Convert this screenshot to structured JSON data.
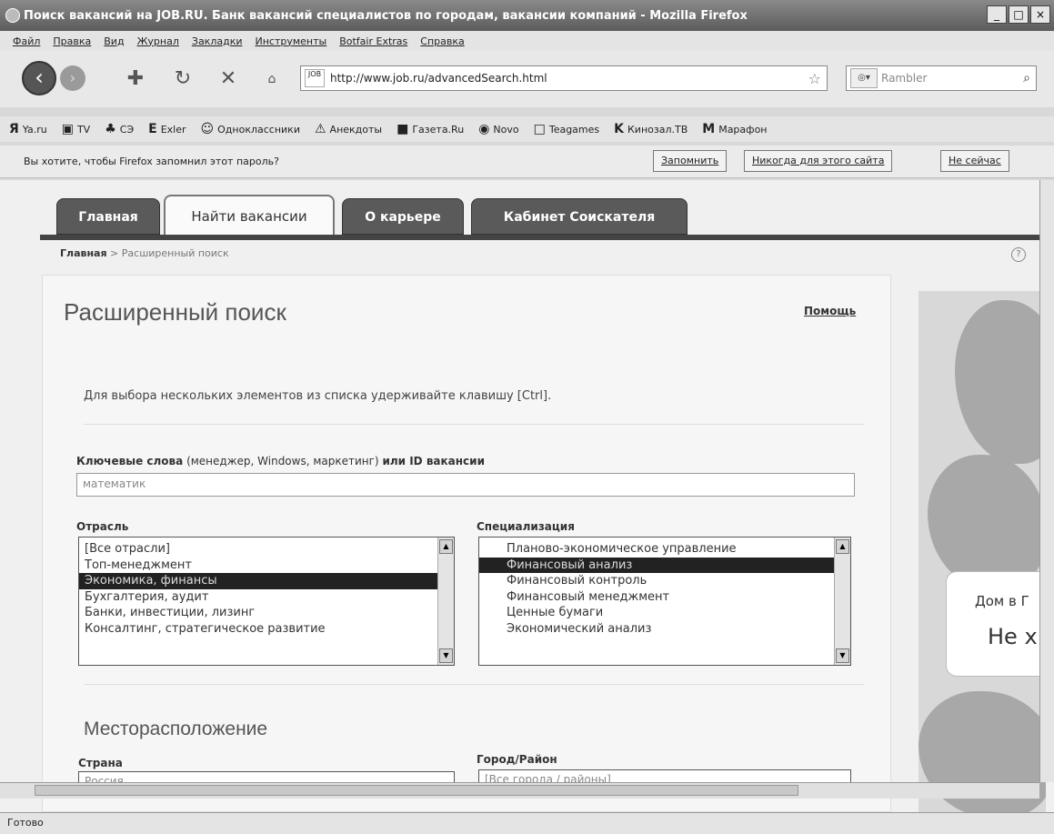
{
  "window": {
    "title": "Поиск вакансий на JOB.RU. Банк вакансий специалистов по городам, вакансии компаний - Mozilla Firefox",
    "controls": [
      "_",
      "□",
      "×"
    ]
  },
  "menu": [
    "Файл",
    "Правка",
    "Вид",
    "Журнал",
    "Закладки",
    "Инструменты",
    "Botfair Extras",
    "Справка"
  ],
  "nav": {
    "url": "http://www.job.ru/advancedSearch.html",
    "site_badge": "JOB",
    "search_engine": "Rambler"
  },
  "bookmarks": [
    {
      "icon": "Я",
      "label": "Ya.ru"
    },
    {
      "icon": "▣",
      "label": "TV"
    },
    {
      "icon": "♣",
      "label": "СЭ"
    },
    {
      "icon": "E",
      "label": "Exler"
    },
    {
      "icon": "☺",
      "label": "Одноклассники"
    },
    {
      "icon": "⚠",
      "label": "Анекдоты"
    },
    {
      "icon": "■",
      "label": "Газета.Ru"
    },
    {
      "icon": "◉",
      "label": "Novo"
    },
    {
      "icon": "□",
      "label": "Teagames"
    },
    {
      "icon": "K",
      "label": "Кинозал.ТВ"
    },
    {
      "icon": "M",
      "label": "Марафон"
    }
  ],
  "notification": {
    "text": "Вы хотите, чтобы Firefox запомнил этот пароль?",
    "remember": "Запомнить",
    "never": "Никогда для этого сайта",
    "not_now": "Не сейчас"
  },
  "tabs": [
    "Главная",
    "Найти вакансии",
    "О карьере",
    "Кабинет Соискателя"
  ],
  "breadcrumb": {
    "home": "Главная",
    "separator": " > ",
    "current": "Расширенный поиск"
  },
  "form": {
    "title": "Расширенный поиск",
    "help": "Помощь",
    "hint": "Для выбора нескольких элементов из списка удерживайте клавишу [Ctrl].",
    "keywords_label_bold": "Ключевые слова",
    "keywords_label_mid": " (менеджер, Windows, маркетинг) ",
    "keywords_label_bold2": "или ID вакансии",
    "keywords_value": "математик",
    "industry_label": "Отрасль",
    "industry_options": [
      "[Все отрасли]",
      "Топ-менеджмент",
      "Экономика, финансы",
      "Бухгалтерия, аудит",
      "Банки, инвестиции, лизинг",
      "Консалтинг, стратегическое развитие"
    ],
    "industry_selected": 2,
    "spec_label": "Специализация",
    "spec_options": [
      "Планово-экономическое управление",
      "Финансовый анализ",
      "Финансовый контроль",
      "Финансовый менеджмент",
      "Ценные бумаги",
      "Экономический анализ"
    ],
    "spec_selected": 1,
    "location_title": "Месторасположение",
    "country_label": "Страна",
    "country_value": "Россия",
    "city_label": "Город/Район",
    "city_value": "[Все города / районы]"
  },
  "ad": {
    "line1": "Дом в Г",
    "line2": "Не х"
  },
  "status": "Готово"
}
